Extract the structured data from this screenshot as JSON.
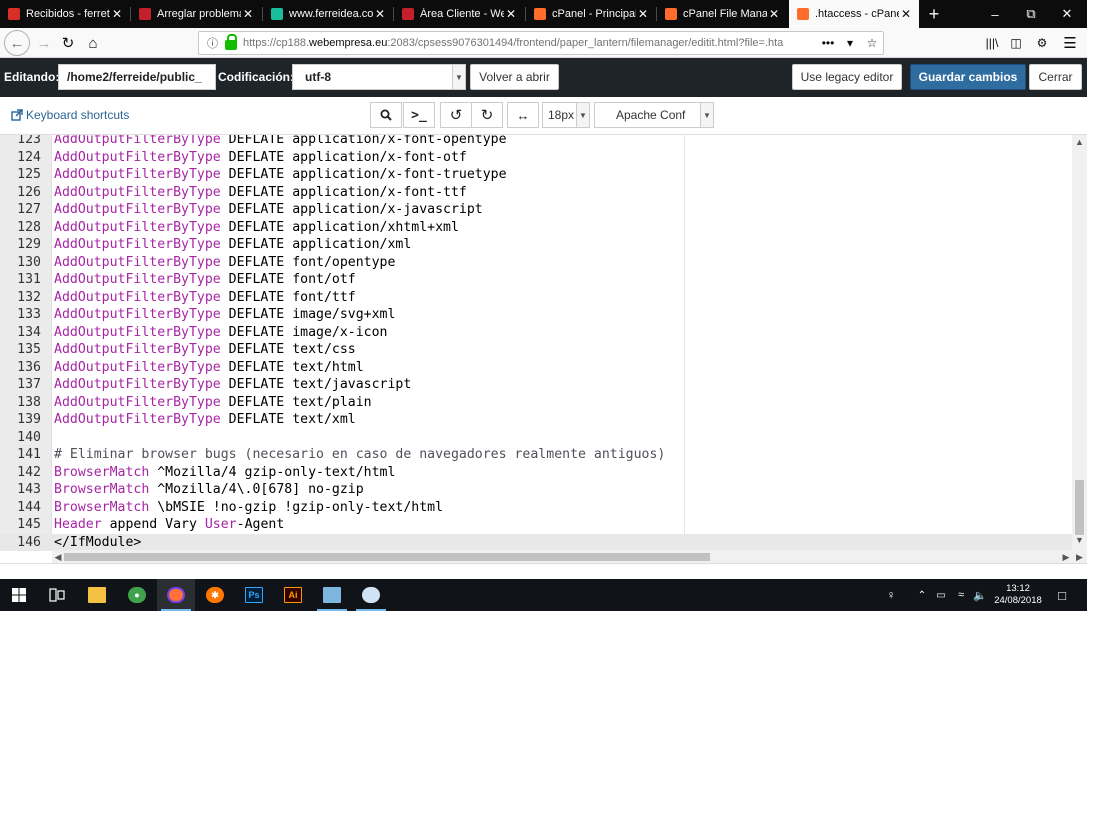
{
  "browser": {
    "tabs": [
      {
        "title": "Recibidos - ferreten",
        "icon": "gmail-icon",
        "color": "#d93025",
        "glyph": "M"
      },
      {
        "title": "Arreglar problemas",
        "icon": "webempresa-icon",
        "color": "#c4202b",
        "glyph": "W"
      },
      {
        "title": "www.ferreidea.com",
        "icon": "ferreidea-icon",
        "color": "#1abc9c",
        "glyph": ""
      },
      {
        "title": "Área Cliente - Webe",
        "icon": "webempresa-icon",
        "color": "#c4202b",
        "glyph": "W"
      },
      {
        "title": "cPanel - Principal",
        "icon": "cpanel-icon",
        "color": "#ff6c2c",
        "glyph": "cP"
      },
      {
        "title": "cPanel File Manage",
        "icon": "cpanel-icon",
        "color": "#ff6c2c",
        "glyph": "cP"
      },
      {
        "title": ".htaccess - cPanel F",
        "icon": "cpanel-icon",
        "color": "#ff6c2c",
        "glyph": "cP"
      }
    ],
    "active_tab_index": 6,
    "url_prefix": "https://cp188.",
    "url_domain": "webempresa.eu",
    "url_suffix": ":2083/cpsess9076301494/frontend/paper_lantern/filemanager/editit.html?file=.hta"
  },
  "editor_header": {
    "editing_label": "Editando:",
    "path_value": "/home2/ferreide/public_",
    "encoding_label": "Codificación:",
    "encoding_value": "utf-8",
    "reopen_button": "Volver a abrir",
    "legacy_button": "Use legacy editor",
    "save_button": "Guardar cambios",
    "close_button": "Cerrar"
  },
  "toolbar": {
    "keyboard_shortcuts": "Keyboard shortcuts",
    "font_size": "18px",
    "mode": "Apache Conf"
  },
  "code": {
    "current_line": 146,
    "lines": [
      {
        "n": "123",
        "parts": [
          [
            "dir",
            "AddOutputFilterByType"
          ],
          [
            "txt",
            " DEFLATE application/x-font-opentype"
          ]
        ]
      },
      {
        "n": "124",
        "parts": [
          [
            "dir",
            "AddOutputFilterByType"
          ],
          [
            "txt",
            " DEFLATE application/x-font-otf"
          ]
        ]
      },
      {
        "n": "125",
        "parts": [
          [
            "dir",
            "AddOutputFilterByType"
          ],
          [
            "txt",
            " DEFLATE application/x-font-truetype"
          ]
        ]
      },
      {
        "n": "126",
        "parts": [
          [
            "dir",
            "AddOutputFilterByType"
          ],
          [
            "txt",
            " DEFLATE application/x-font-ttf"
          ]
        ]
      },
      {
        "n": "127",
        "parts": [
          [
            "dir",
            "AddOutputFilterByType"
          ],
          [
            "txt",
            " DEFLATE application/x-javascript"
          ]
        ]
      },
      {
        "n": "128",
        "parts": [
          [
            "dir",
            "AddOutputFilterByType"
          ],
          [
            "txt",
            " DEFLATE application/xhtml+xml"
          ]
        ]
      },
      {
        "n": "129",
        "parts": [
          [
            "dir",
            "AddOutputFilterByType"
          ],
          [
            "txt",
            " DEFLATE application/xml"
          ]
        ]
      },
      {
        "n": "130",
        "parts": [
          [
            "dir",
            "AddOutputFilterByType"
          ],
          [
            "txt",
            " DEFLATE font/opentype"
          ]
        ]
      },
      {
        "n": "131",
        "parts": [
          [
            "dir",
            "AddOutputFilterByType"
          ],
          [
            "txt",
            " DEFLATE font/otf"
          ]
        ]
      },
      {
        "n": "132",
        "parts": [
          [
            "dir",
            "AddOutputFilterByType"
          ],
          [
            "txt",
            " DEFLATE font/ttf"
          ]
        ]
      },
      {
        "n": "133",
        "parts": [
          [
            "dir",
            "AddOutputFilterByType"
          ],
          [
            "txt",
            " DEFLATE image/svg+xml"
          ]
        ]
      },
      {
        "n": "134",
        "parts": [
          [
            "dir",
            "AddOutputFilterByType"
          ],
          [
            "txt",
            " DEFLATE image/x-icon"
          ]
        ]
      },
      {
        "n": "135",
        "parts": [
          [
            "dir",
            "AddOutputFilterByType"
          ],
          [
            "txt",
            " DEFLATE text/css"
          ]
        ]
      },
      {
        "n": "136",
        "parts": [
          [
            "dir",
            "AddOutputFilterByType"
          ],
          [
            "txt",
            " DEFLATE text/html"
          ]
        ]
      },
      {
        "n": "137",
        "parts": [
          [
            "dir",
            "AddOutputFilterByType"
          ],
          [
            "txt",
            " DEFLATE text/javascript"
          ]
        ]
      },
      {
        "n": "138",
        "parts": [
          [
            "dir",
            "AddOutputFilterByType"
          ],
          [
            "txt",
            " DEFLATE text/plain"
          ]
        ]
      },
      {
        "n": "139",
        "parts": [
          [
            "dir",
            "AddOutputFilterByType"
          ],
          [
            "txt",
            " DEFLATE text/xml"
          ]
        ]
      },
      {
        "n": "140",
        "parts": []
      },
      {
        "n": "141",
        "parts": [
          [
            "cmt",
            "# Eliminar browser bugs (necesario en caso de navegadores realmente antiguos)"
          ]
        ]
      },
      {
        "n": "142",
        "parts": [
          [
            "dir",
            "BrowserMatch"
          ],
          [
            "txt",
            " ^Mozilla/4 gzip-only-text/html"
          ]
        ]
      },
      {
        "n": "143",
        "parts": [
          [
            "dir",
            "BrowserMatch"
          ],
          [
            "txt",
            " ^Mozilla/4\\.0[678] no-gzip"
          ]
        ]
      },
      {
        "n": "144",
        "parts": [
          [
            "dir",
            "BrowserMatch"
          ],
          [
            "txt",
            " \\bMSIE !no-gzip !gzip-only-text/html"
          ]
        ]
      },
      {
        "n": "145",
        "parts": [
          [
            "dir",
            "Header"
          ],
          [
            "txt",
            " append Vary "
          ],
          [
            "kw",
            "User"
          ],
          [
            "txt",
            "-Agent"
          ]
        ]
      },
      {
        "n": "146",
        "parts": [
          [
            "txt",
            "</IfModule>"
          ]
        ]
      }
    ]
  },
  "taskbar": {
    "icons": [
      "windows-start-icon",
      "task-view-icon",
      "file-explorer-icon",
      "globe-app-icon",
      "firefox-icon",
      "avast-icon",
      "photoshop-icon",
      "illustrator-icon",
      "notepad-app-icon",
      "paint-app-icon"
    ],
    "time": "13:12",
    "date": "24/08/2018"
  }
}
